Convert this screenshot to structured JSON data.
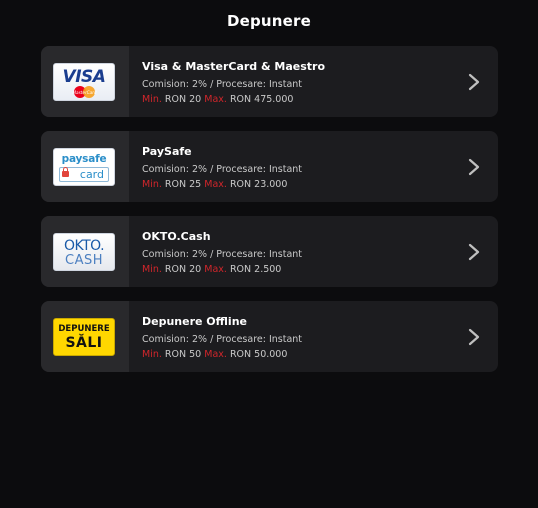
{
  "page": {
    "title": "Depunere"
  },
  "labels": {
    "min": "Min.",
    "max": "Max."
  },
  "methods": [
    {
      "name": "Visa & MasterCard & Maestro",
      "fee": "Comision: 2% / Procesare: Instant",
      "min": "RON 20",
      "max": "RON 475.000",
      "logo": {
        "text": "VISA",
        "sub": "MasterCard"
      }
    },
    {
      "name": "PaySafe",
      "fee": "Comision: 2% / Procesare: Instant",
      "min": "RON 25",
      "max": "RON 23.000",
      "logo": {
        "text": "paysafe",
        "sub": "card"
      }
    },
    {
      "name": "OKTO.Cash",
      "fee": "Comision: 2% / Procesare: Instant",
      "min": "RON 20",
      "max": "RON 2.500",
      "logo": {
        "text": "OKTO.",
        "sub": "CASH"
      }
    },
    {
      "name": "Depunere Offline",
      "fee": "Comision: 2% / Procesare: Instant",
      "min": "RON 50",
      "max": "RON 50.000",
      "logo": {
        "text": "DEPUNERE",
        "sub": "SĂLI"
      }
    }
  ],
  "colors": {
    "background": "#0c0c0e",
    "card": "#1c1c1f",
    "limit_label": "#d0262b"
  },
  "icons": {
    "chevron": "chevron-right-icon"
  }
}
